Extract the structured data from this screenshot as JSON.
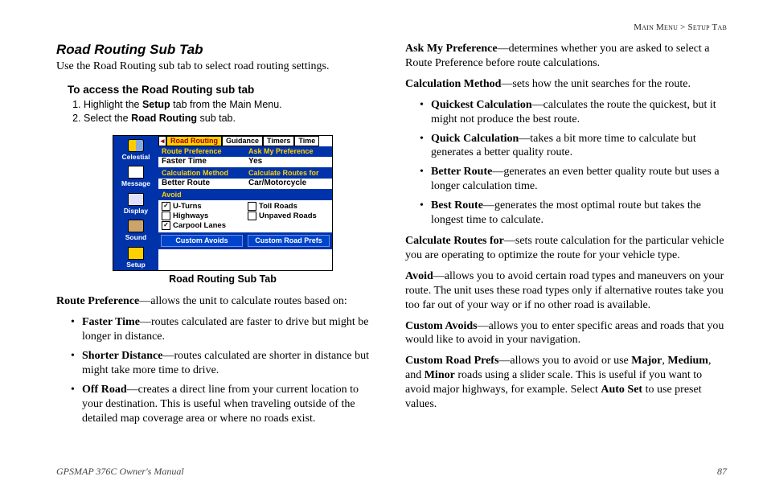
{
  "breadcrumb": {
    "left": "Main Menu",
    "sep": " > ",
    "right": "Setup Tab"
  },
  "left": {
    "heading": "Road Routing Sub Tab",
    "intro": "Use the Road Routing sub tab to select road routing settings.",
    "access_head": "To access the Road Routing sub tab",
    "steps": {
      "s1a": "Highlight the ",
      "s1b": "Setup",
      "s1c": " tab from the Main Menu.",
      "s2a": "Select the ",
      "s2b": "Road Routing",
      "s2c": " sub tab."
    },
    "caption": "Road Routing Sub Tab",
    "rp_lead": "Route Preference",
    "rp_body": "—allows the unit to calculate routes based on:",
    "rp": {
      "b1t": "Faster Time",
      "b1d": "—routes calculated are faster to drive but might be longer in distance.",
      "b2t": "Shorter Distance",
      "b2d": "—routes calculated are shorter in distance but might take more time to drive.",
      "b3t": "Off Road",
      "b3d": "—creates a direct line from your current location to your destination. This is useful when  traveling outside of the detailed map coverage area or where no roads exist."
    }
  },
  "right": {
    "amp_t": "Ask My Preference",
    "amp_d": "—determines whether you are asked to select a Route Preference before route calculations.",
    "cm_t": "Calculation Method",
    "cm_d": "—sets how the unit searches for the route.",
    "cm": {
      "b1t": "Quickest Calculation",
      "b1d": "—calculates the route the quickest, but it might not produce the best route.",
      "b2t": "Quick Calculation",
      "b2d": "—takes a bit more time to calculate but generates a better quality route.",
      "b3t": "Better Route",
      "b3d": "—generates an even better quality route but uses a longer calculation time.",
      "b4t": "Best Route",
      "b4d": "—generates the most optimal route but takes the longest time to calculate."
    },
    "crf_t": "Calculate Routes for",
    "crf_d": "—sets route calculation for the particular vehicle you are operating to optimize the route for your vehicle type.",
    "av_t": "Avoid",
    "av_d": "—allows you to avoid certain road types and maneuvers on your route. The unit uses these road types only if alternative routes take you too far out of your way or if no other road is available.",
    "ca_t": "Custom Avoids",
    "ca_d": "—allows you to enter specific areas and roads that you would like to avoid in your navigation.",
    "crp_t": "Custom Road Prefs",
    "crp_d1": "—allows you to avoid or use ",
    "crp_major": "Major",
    "crp_comma1": ", ",
    "crp_medium": "Medium",
    "crp_comma2": ", and ",
    "crp_minor": "Minor",
    "crp_d2": " roads using a slider scale. This is useful if you want to avoid major highways, for example. Select ",
    "crp_auto": "Auto Set",
    "crp_d3": " to use preset values."
  },
  "fig": {
    "side": {
      "celestial": "Celestial",
      "message": "Message",
      "display": "Display",
      "sound": "Sound",
      "setup": "Setup"
    },
    "tabs": {
      "lead": "◂",
      "rr": "Road Routing",
      "g": "Guidance",
      "tm": "Timers",
      "ti": "Time"
    },
    "head": {
      "rp": "Route Preference",
      "amp": "Ask My Preference",
      "cm": "Calculation Method",
      "crf": "Calculate Routes for",
      "av": "Avoid"
    },
    "val": {
      "rp": "Faster Time",
      "amp": "Yes",
      "cm": "Better Route",
      "crf": "Car/Motorcycle"
    },
    "avoid": {
      "uturns": {
        "label": "U-Turns",
        "checked": true
      },
      "toll": {
        "label": "Toll Roads",
        "checked": false
      },
      "hwy": {
        "label": "Highways",
        "checked": false
      },
      "unpaved": {
        "label": "Unpaved Roads",
        "checked": false
      },
      "carpool": {
        "label": "Carpool Lanes",
        "checked": true
      }
    },
    "btn": {
      "ca": "Custom Avoids",
      "crp": "Custom Road Prefs"
    }
  },
  "footer": {
    "left": "GPSMAP 376C Owner's Manual",
    "right": "87"
  }
}
